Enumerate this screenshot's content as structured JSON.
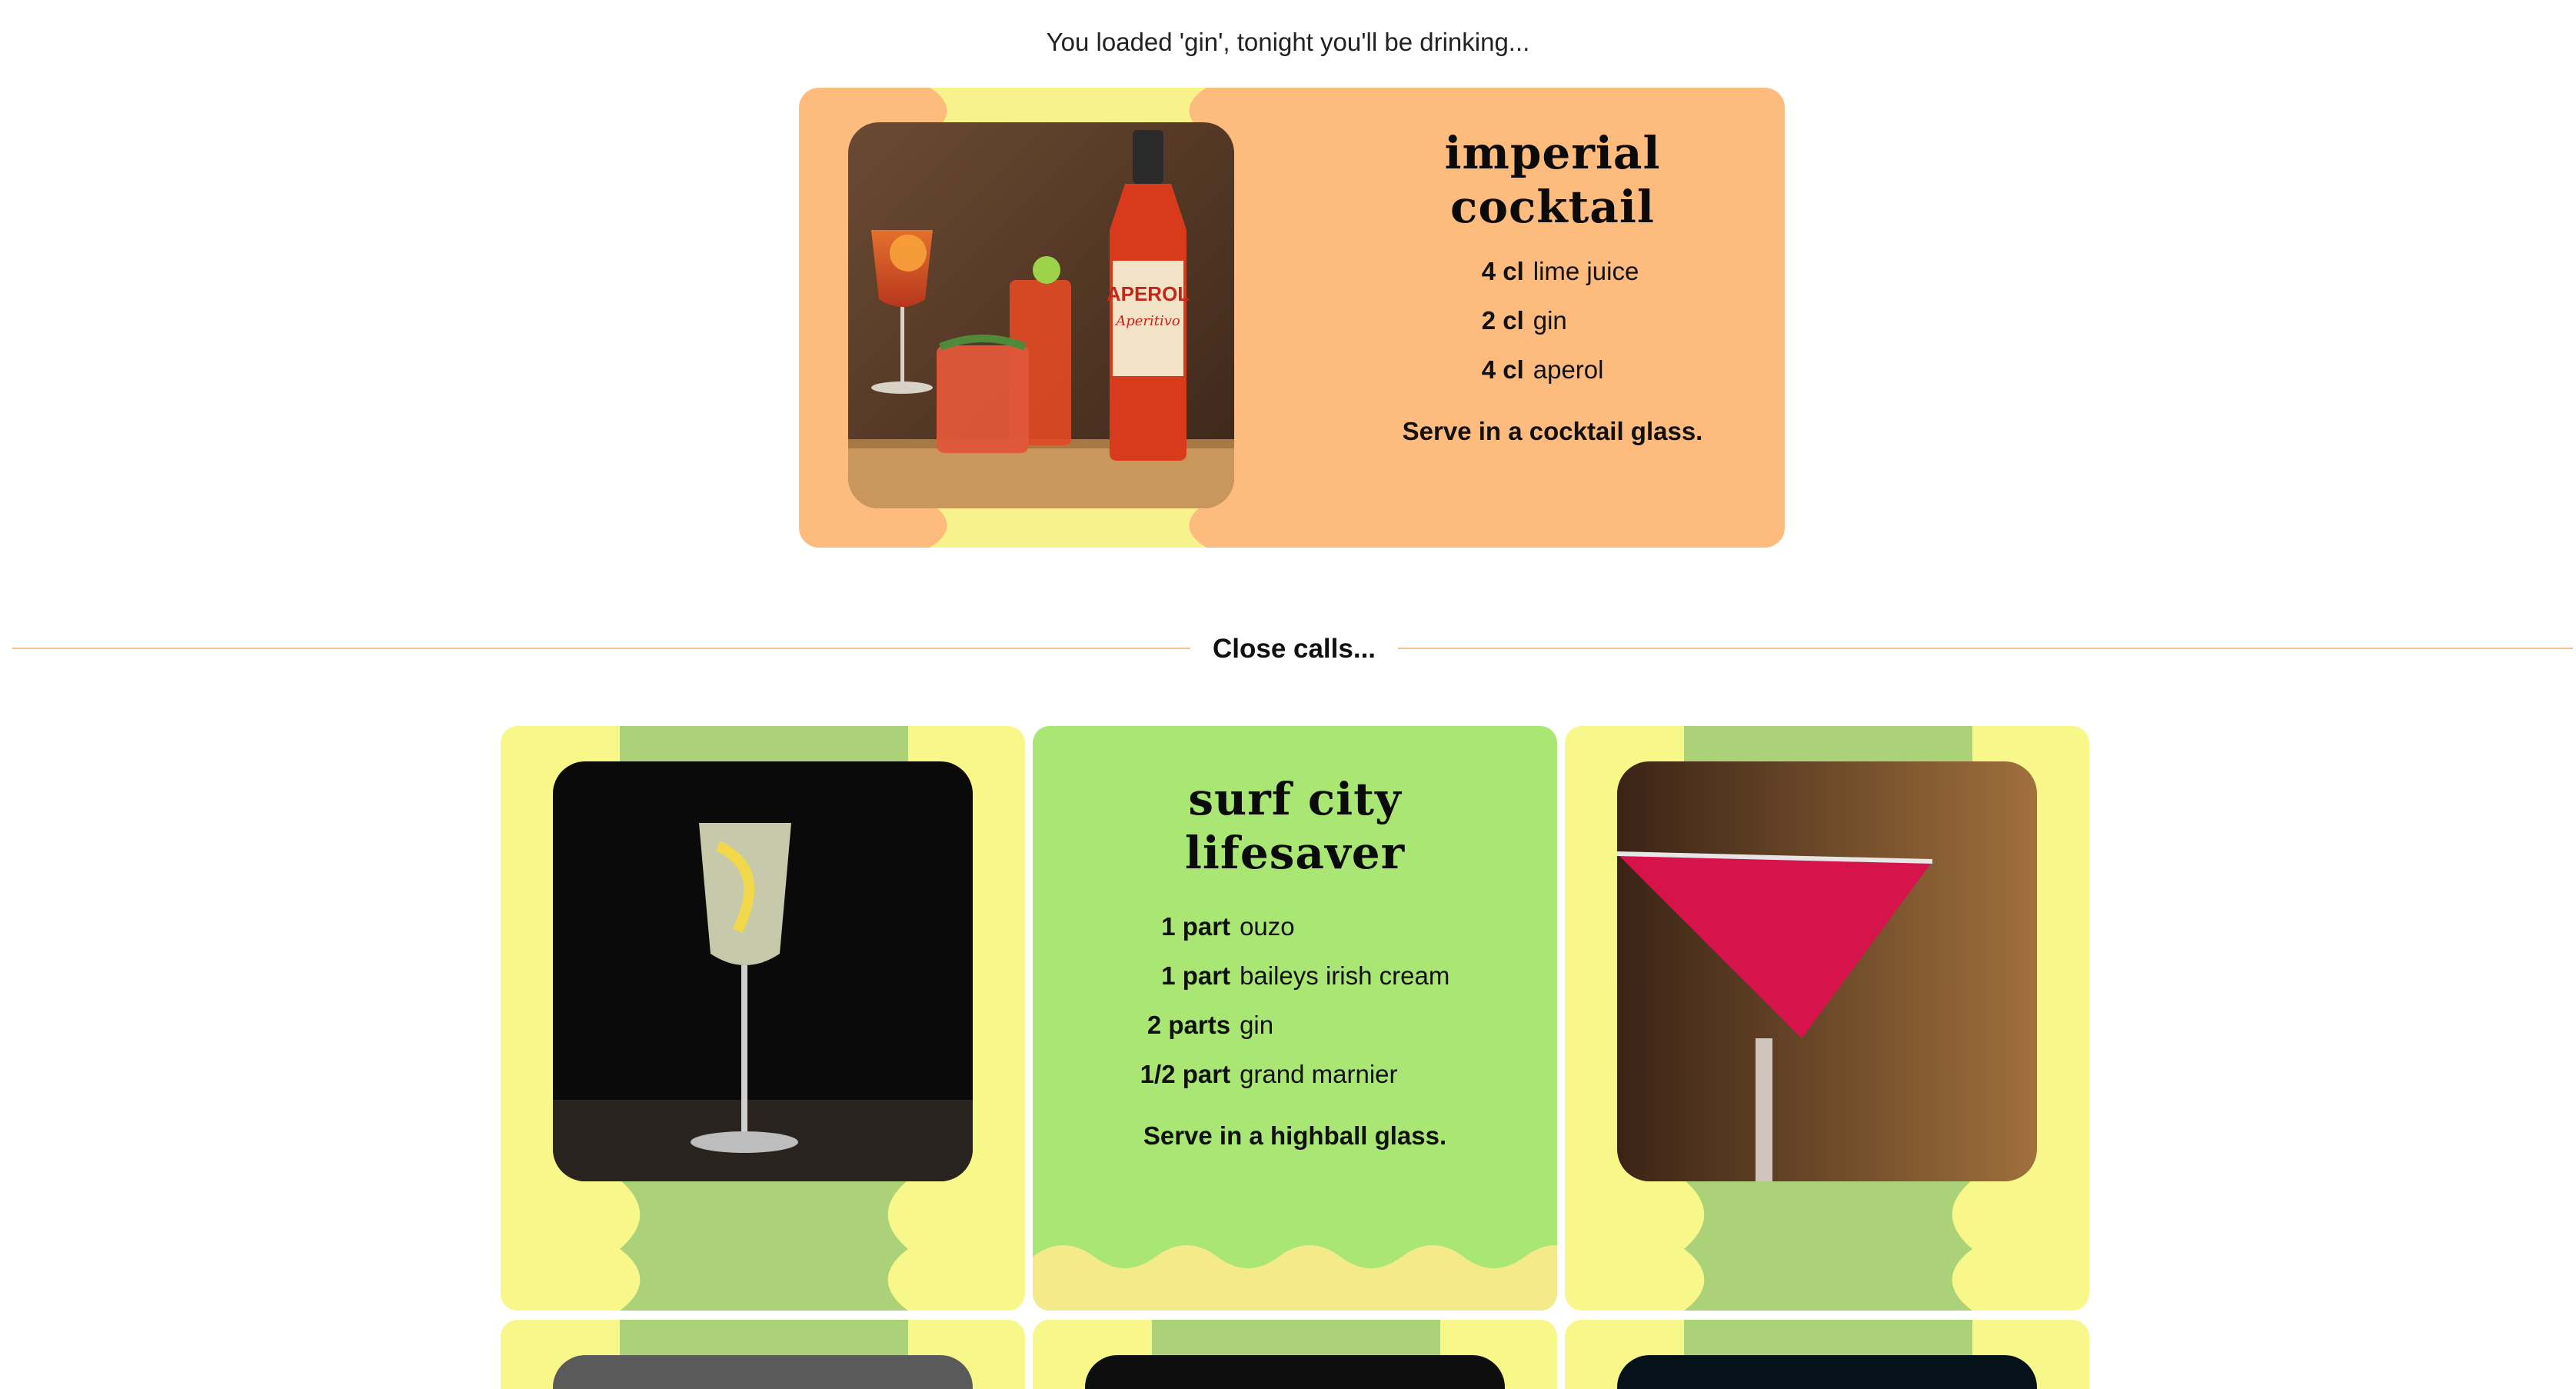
{
  "intro_text": "You loaded 'gin', tonight you'll be drinking...",
  "featured": {
    "title_line1": "imperial",
    "title_line2": "cocktail",
    "ingredients": [
      {
        "amount": "4 cl",
        "name": "lime juice"
      },
      {
        "amount": "2 cl",
        "name": "gin"
      },
      {
        "amount": "4 cl",
        "name": "aperol"
      }
    ],
    "serve": "Serve in a cocktail glass.",
    "bottle_label": "APEROL",
    "bottle_sub": "Aperitivo"
  },
  "divider_label": "Close calls...",
  "close_calls": {
    "middle": {
      "title_line1": "surf city",
      "title_line2": "lifesaver",
      "ingredients": [
        {
          "amount": "1 part",
          "name": "ouzo"
        },
        {
          "amount": "1 part",
          "name": "baileys irish cream"
        },
        {
          "amount": "2 parts",
          "name": "gin"
        },
        {
          "amount": "1/2 part",
          "name": "grand marnier"
        }
      ],
      "serve": "Serve in a highball glass."
    }
  },
  "colors": {
    "featured_bg": "#fdbb7e",
    "featured_stripe": "#f8f28c",
    "card_yellow": "#f8f88a",
    "card_green": "#a9e674",
    "band_green": "#abd279",
    "divider": "#f6c08b"
  }
}
